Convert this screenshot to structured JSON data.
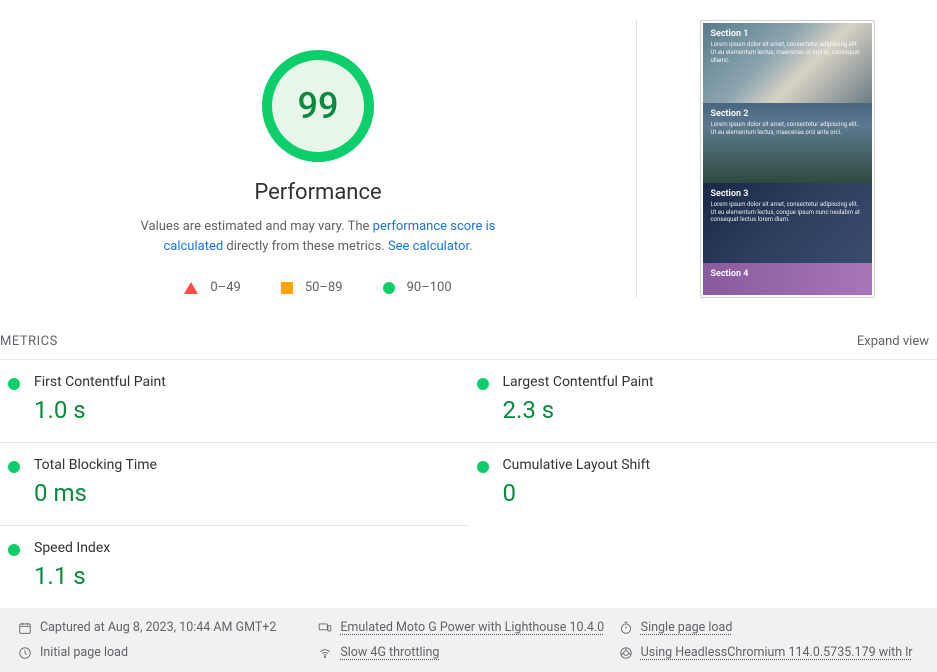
{
  "gauge": {
    "score": "99",
    "title": "Performance",
    "percent": 99
  },
  "description": {
    "prefix": "Values are estimated and may vary. The ",
    "link1": "performance score is calculated",
    "middle": " directly from these metrics. ",
    "link2": "See calculator"
  },
  "legend": {
    "fail": "0–49",
    "avg": "50–89",
    "pass": "90–100"
  },
  "preview": {
    "sections": [
      {
        "title": "Section 1",
        "text": "Lorem ipsum dolor sit amet, consectetur adipiscing elit. Ut eu elementum lectus, maecenas ut orci ut, consequat ullamc."
      },
      {
        "title": "Section 2",
        "text": "Lorem ipsum dolor sit amet, consectetur adipiscing elit. Ut eu elementum lectus, maecenas orci ante orci."
      },
      {
        "title": "Section 3",
        "text": "Lorem ipsum dolor sit amet, consectetur adipiscing elit. Ut eu elementum lectus, congue ipsum nunc neulabm at consequat lectus lorem diam."
      },
      {
        "title": "Section 4",
        "text": ""
      }
    ]
  },
  "metrics_header": {
    "title": "METRICS",
    "expand": "Expand view"
  },
  "metrics": [
    {
      "label": "First Contentful Paint",
      "value": "1.0 s"
    },
    {
      "label": "Largest Contentful Paint",
      "value": "2.3 s"
    },
    {
      "label": "Total Blocking Time",
      "value": "0 ms"
    },
    {
      "label": "Cumulative Layout Shift",
      "value": "0"
    },
    {
      "label": "Speed Index",
      "value": "1.1 s"
    }
  ],
  "footer": {
    "captured": "Captured at Aug 8, 2023, 10:44 AM GMT+2",
    "device": "Emulated Moto G Power with Lighthouse 10.4.0",
    "load_type": "Single page load",
    "initial": "Initial page load",
    "throttle": "Slow 4G throttling",
    "browser": "Using HeadlessChromium 114.0.5735.179 with lr"
  }
}
